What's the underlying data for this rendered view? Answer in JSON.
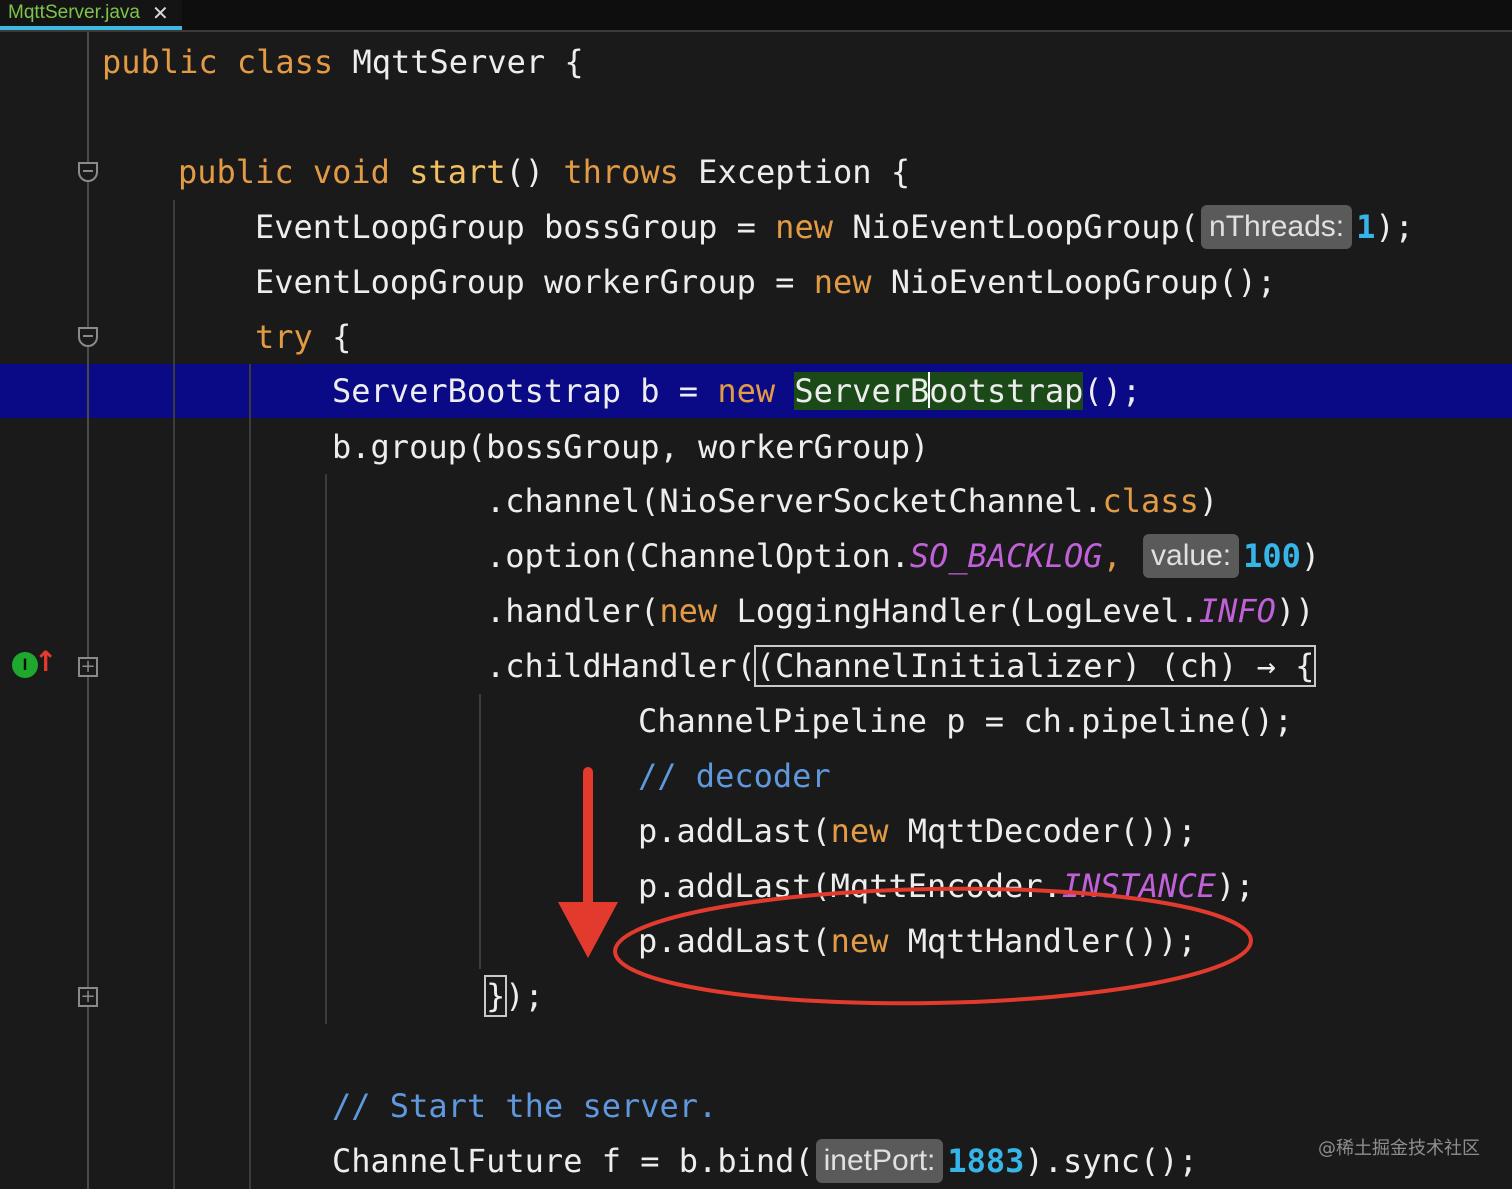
{
  "tab": {
    "filename": "MqttServer.java",
    "close_icon": "✕"
  },
  "watermark": "@稀土掘金技术社区",
  "colors": {
    "keyword": "#e29a45",
    "number": "#36b6e8",
    "static_field": "#c061d8",
    "comment": "#5f98dd",
    "current_line": "#0a0a86",
    "annotation_red": "#e23b2e"
  },
  "gutter": {
    "implements_icon_label": "I",
    "implements_arrow": "↑"
  },
  "code": {
    "l1": {
      "a": "public class ",
      "b": "MqttServer {"
    },
    "l2": {
      "a": "public void ",
      "b": "start",
      "c": "() ",
      "d": "throws ",
      "e": "Exception {"
    },
    "l3": {
      "a": "EventLoopGroup bossGroup = ",
      "b": "new ",
      "c": "NioEventLoopGroup(",
      "hint": "nThreads:",
      "num": "1",
      "d": ");"
    },
    "l4": {
      "a": "EventLoopGroup workerGroup = ",
      "b": "new ",
      "c": "NioEventLoopGroup();"
    },
    "l5": {
      "a": "try ",
      "b": "{"
    },
    "l6": {
      "a": "ServerBootstrap b = ",
      "b": "new ",
      "c1": "ServerB",
      "c2": "ootstrap",
      "d": "();"
    },
    "l7": {
      "a": "b.group(bossGroup, workerGroup)"
    },
    "l8": {
      "a": ".channel(NioServerSocketChannel.",
      "b": "class",
      "c": ")"
    },
    "l9": {
      "a": ".option(ChannelOption.",
      "b": "SO_BACKLOG",
      "c": ", ",
      "hint": "value:",
      "num": "100",
      "d": ")"
    },
    "l10": {
      "a": ".handler(",
      "b": "new ",
      "c": "LoggingHandler(LogLevel.",
      "d": "INFO",
      "e": "))"
    },
    "l11": {
      "a": ".childHandler(",
      "b": "(ChannelInitializer) (ch) → {"
    },
    "l12": {
      "a": "ChannelPipeline p = ch.pipeline();"
    },
    "l13": {
      "a": "// decoder"
    },
    "l14": {
      "a": "p.addLast(",
      "b": "new ",
      "c": "MqttDecoder());"
    },
    "l15": {
      "a": "p.addLast(MqttEncoder.",
      "b": "INSTANCE",
      "c": ");"
    },
    "l16": {
      "a": "p.addLast(",
      "b": "new ",
      "c": "MqttHandler());"
    },
    "l17": {
      "a": "}",
      "b": ");"
    },
    "l18": {
      "a": "// Start the server."
    },
    "l19": {
      "a": "ChannelFuture f = b.bind(",
      "hint": "inetPort:",
      "num": "1883",
      "b": ").sync();"
    }
  }
}
